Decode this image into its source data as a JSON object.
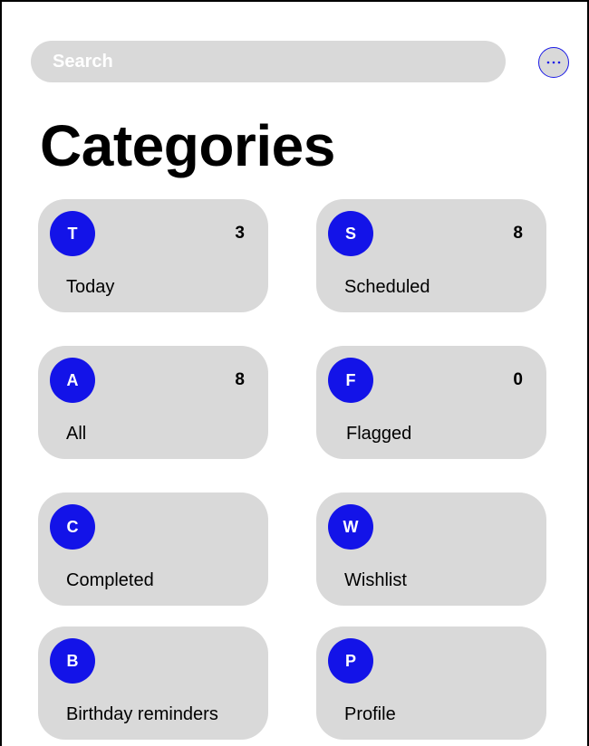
{
  "search": {
    "placeholder": "Search"
  },
  "header": {
    "title": "Categories",
    "more_icon": "ellipsis-icon",
    "accent_color": "#1313e8"
  },
  "categories": [
    {
      "initial": "T",
      "label": "Today",
      "count": "3"
    },
    {
      "initial": "S",
      "label": "Scheduled",
      "count": "8"
    },
    {
      "initial": "A",
      "label": "All",
      "count": "8"
    },
    {
      "initial": "F",
      "label": "Flagged",
      "count": "0"
    },
    {
      "initial": "C",
      "label": "Completed",
      "count": ""
    },
    {
      "initial": "W",
      "label": "Wishlist",
      "count": ""
    },
    {
      "initial": "B",
      "label": "Birthday reminders",
      "count": ""
    },
    {
      "initial": "P",
      "label": "Profile",
      "count": ""
    }
  ]
}
